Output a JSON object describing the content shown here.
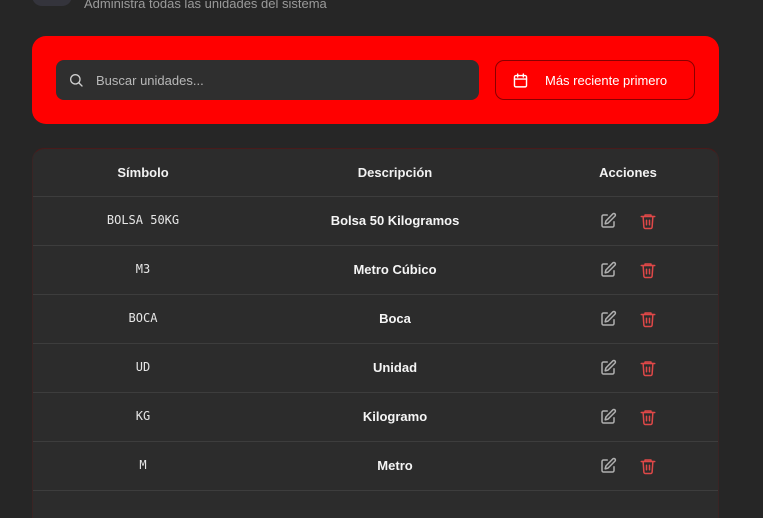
{
  "header": {
    "subtitle": "Administra todas las unidades del sistema"
  },
  "filters": {
    "search_placeholder": "Buscar unidades...",
    "sort_label": "Más reciente primero"
  },
  "table": {
    "columns": [
      "Símbolo",
      "Descripción",
      "Acciones"
    ],
    "rows": [
      {
        "symbol": "BOLSA 50KG",
        "description": "Bolsa 50 Kilogramos"
      },
      {
        "symbol": "M3",
        "description": "Metro Cúbico"
      },
      {
        "symbol": "BOCA",
        "description": "Boca"
      },
      {
        "symbol": "UD",
        "description": "Unidad"
      },
      {
        "symbol": "KG",
        "description": "Kilogramo"
      },
      {
        "symbol": "M",
        "description": "Metro"
      }
    ]
  },
  "colors": {
    "accent": "#ff0000",
    "background": "#262626",
    "card": "#2c2c2c",
    "delete_icon": "#e04848",
    "edit_icon": "#b0b0b0"
  },
  "icons": {
    "search": "search-icon",
    "sort": "calendar-icon",
    "edit": "edit-icon",
    "delete": "trash-icon"
  }
}
